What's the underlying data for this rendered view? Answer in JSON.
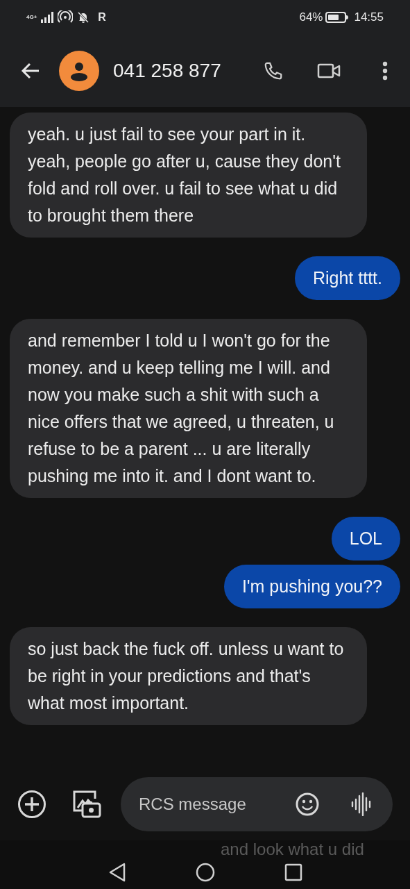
{
  "status_bar": {
    "network": "4G+",
    "roaming": "R",
    "battery_text": "64%",
    "time": "14:55"
  },
  "header": {
    "title": "041 258 877"
  },
  "messages": [
    {
      "kind": "received",
      "text": "yeah. u just fail to see your part in it. yeah, people go after u, cause they don't fold and roll over. u fail to see what u did to brought them there"
    },
    {
      "kind": "sent",
      "text": "Right tttt."
    },
    {
      "kind": "received",
      "text": "and remember I told u I won't go for the money. and u keep telling me I will. and now you make such a shit with such a nice offers that we agreed, u threaten, u refuse to be a parent ... u are literally pushing me into it. and I dont want to."
    },
    {
      "kind": "sent",
      "text": "LOL"
    },
    {
      "kind": "sent",
      "text": "I'm pushing you??"
    },
    {
      "kind": "received",
      "text": "so just back the fuck off. unless u want to be right in your predictions and that's what most important."
    }
  ],
  "composer": {
    "placeholder": "RCS message"
  },
  "ghost_text": "and look what u did"
}
